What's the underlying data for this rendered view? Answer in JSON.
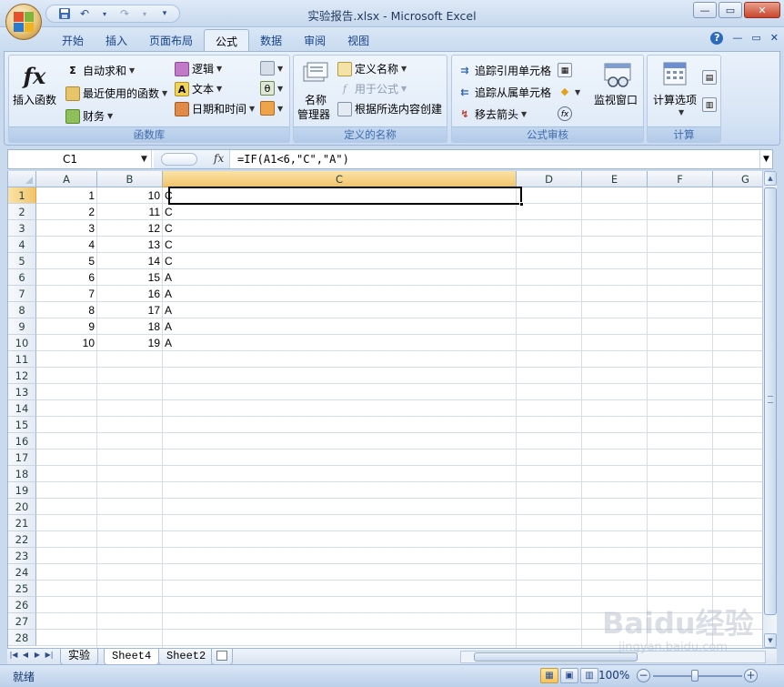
{
  "window": {
    "title": "实验报告.xlsx - Microsoft Excel",
    "controls": {
      "minimize": "—",
      "restore": "▭",
      "close": "✕"
    }
  },
  "qat": {
    "save_icon": "save-icon",
    "undo_icon": "undo-icon",
    "redo_icon": "redo-icon",
    "customize": "▾"
  },
  "tabs": [
    {
      "label": "开始",
      "active": false
    },
    {
      "label": "插入",
      "active": false
    },
    {
      "label": "页面布局",
      "active": false
    },
    {
      "label": "公式",
      "active": true
    },
    {
      "label": "数据",
      "active": false
    },
    {
      "label": "审阅",
      "active": false
    },
    {
      "label": "视图",
      "active": false
    }
  ],
  "tab_right": {
    "help": "?",
    "minimize": "—",
    "restore": "▭",
    "close": "✕"
  },
  "ribbon": {
    "function_library": {
      "label": "函数库",
      "insert_function_line1": "插入函数",
      "autosum": "自动求和",
      "recent": "最近使用的函数",
      "financial": "财务",
      "logical": "逻辑",
      "text": "文本",
      "datetime": "日期和时间"
    },
    "defined_names": {
      "label": "定义的名称",
      "name_manager_line1": "名称",
      "name_manager_line2": "管理器",
      "define_name": "定义名称",
      "use_in_formula": "用于公式",
      "create_from_selection": "根据所选内容创建"
    },
    "formula_auditing": {
      "label": "公式审核",
      "trace_precedents": "追踪引用单元格",
      "trace_dependents": "追踪从属单元格",
      "remove_arrows": "移去箭头",
      "watch_window": "监视窗口"
    },
    "calculation": {
      "label": "计算",
      "calc_options": "计算选项"
    }
  },
  "formula_bar": {
    "name_box": "C1",
    "fx": "fx",
    "formula": "=IF(A1<6,\"C\",\"A\")"
  },
  "columns": [
    "A",
    "B",
    "C",
    "D",
    "E",
    "F",
    "G"
  ],
  "selected_column": "C",
  "rows": [
    "1",
    "2",
    "3",
    "4",
    "5",
    "6",
    "7",
    "8",
    "9",
    "10",
    "11",
    "12",
    "13",
    "14",
    "15",
    "16",
    "17",
    "18",
    "19",
    "20",
    "21",
    "22",
    "23",
    "24",
    "25",
    "26",
    "27",
    "28"
  ],
  "selected_row": "1",
  "cells": [
    {
      "a": "1",
      "b": "10",
      "c": "C"
    },
    {
      "a": "2",
      "b": "11",
      "c": "C"
    },
    {
      "a": "3",
      "b": "12",
      "c": "C"
    },
    {
      "a": "4",
      "b": "13",
      "c": "C"
    },
    {
      "a": "5",
      "b": "14",
      "c": "C"
    },
    {
      "a": "6",
      "b": "15",
      "c": "A"
    },
    {
      "a": "7",
      "b": "16",
      "c": "A"
    },
    {
      "a": "8",
      "b": "17",
      "c": "A"
    },
    {
      "a": "9",
      "b": "18",
      "c": "A"
    },
    {
      "a": "10",
      "b": "19",
      "c": "A"
    }
  ],
  "sheet_tabs": [
    {
      "label": "实验",
      "active": false
    },
    {
      "label": "Sheet4",
      "active": true
    },
    {
      "label": "Sheet2",
      "active": false
    }
  ],
  "status": {
    "ready": "就绪",
    "zoom": "100%",
    "zoom_minus": "−",
    "zoom_plus": "+"
  },
  "watermark": {
    "brand": "Baidu经验",
    "url": "jingyan.baidu.com"
  }
}
